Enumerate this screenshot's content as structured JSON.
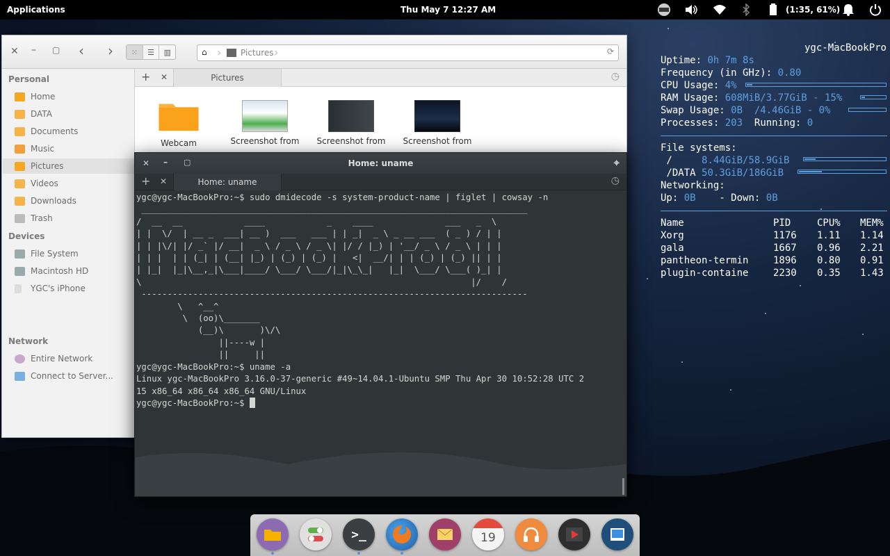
{
  "panel": {
    "applications": "Applications",
    "datetime": "Thu May 7   12:27 AM",
    "battery": "(1:35, 61%)"
  },
  "file_manager": {
    "path": "Pictures",
    "tab_label": "Pictures",
    "sidebar": {
      "personal_heading": "Personal",
      "personal": [
        "Home",
        "DATA",
        "Documents",
        "Music",
        "Pictures",
        "Videos",
        "Downloads",
        "Trash"
      ],
      "devices_heading": "Devices",
      "devices": [
        "File System",
        "Macintosh HD",
        "YGC's iPhone"
      ],
      "network_heading": "Network",
      "network": [
        "Entire Network",
        "Connect to Server..."
      ]
    },
    "files": [
      "Webcam",
      "Screenshot from",
      "Screenshot from",
      "Screenshot from"
    ]
  },
  "terminal": {
    "title": "Home: uname",
    "tab_label": "Home: uname",
    "output": "ygc@ygc-MacBookPro:~$ sudo dmidecode -s system-product-name | figlet | cowsay -n\n ___________________________________________________________________________\n/  __  __            ____            _    ____              ___   _  \\\n| |  \\/  | __ _  ___| __ )  ___   ___ | | _|  _ \\ _ __ ___  ( _ ) / | |\n| | |\\/| |/ _` |/ __|  _ \\ / _ \\ / _ \\| |/ / |_) | '__/ _ \\ / _ \\ | | |\n| | |  | | (_| | (__| |_) | (_) | (_) |   <|  __/| | | (_) | (_) || | |\n| |_|  |_|\\__,_|\\___|____/ \\___/ \\___/|_|\\_\\_|   |_|  \\___/ \\___( )_| |\n\\                                                                |/    /\n ---------------------------------------------------------------------------\n        \\   ^__^\n         \\  (oo)\\_______\n            (__)\\       )\\/\\\n                ||----w |\n                ||     ||\nygc@ygc-MacBookPro:~$ uname -a\nLinux ygc-MacBookPro 3.16.0-37-generic #49~14.04.1-Ubuntu SMP Thu Apr 30 10:52:28 UTC 2\n15 x86_64 x86_64 x86_64 GNU/Linux",
    "prompt": "ygc@ygc-MacBookPro:~$ "
  },
  "conky": {
    "hostname": "ygc-MacBookPro",
    "uptime_label": "Uptime:",
    "uptime": "0h 7m 8s",
    "freq_label": "Frequency (in GHz):",
    "freq": "0.80",
    "cpu_label": "CPU Usage:",
    "cpu": "4%",
    "cpu_fraction": 0.04,
    "ram_label": "RAM Usage:",
    "ram": "608MiB/3.77GiB - 15%",
    "ram_fraction": 0.15,
    "swap_label": "Swap Usage:",
    "swap": "0B  /4.46GiB - 0%",
    "swap_fraction": 0.0,
    "proc_label": "Processes:",
    "proc": "203",
    "running_label": "Running:",
    "running": "0",
    "fs_label": "File systems:",
    "fs": [
      {
        "mount": " /",
        "usage": "8.44GiB/58.9GiB",
        "fraction": 0.14
      },
      {
        "mount": " /DATA",
        "usage": "50.3GiB/186GiB",
        "fraction": 0.27
      }
    ],
    "net_label": "Networking:",
    "up_label": "Up:",
    "up": "0B",
    "down_label": "- Down:",
    "down": "0B",
    "proc_headers": [
      "Name",
      "PID",
      "CPU%",
      "MEM%"
    ],
    "processes": [
      [
        "Xorg",
        "1176",
        "1.11",
        "1.14"
      ],
      [
        "gala",
        "1667",
        "0.96",
        "2.21"
      ],
      [
        "pantheon-termin",
        "1896",
        "0.80",
        "0.91"
      ],
      [
        "plugin-containe",
        "2230",
        "0.35",
        "1.43"
      ]
    ]
  },
  "dock": {
    "calendar_day": "19",
    "apps": [
      "files-icon",
      "switchboard-icon",
      "terminal-icon",
      "firefox-icon",
      "mail-icon",
      "calendar-icon",
      "music-icon",
      "video-icon",
      "photos-icon"
    ]
  }
}
